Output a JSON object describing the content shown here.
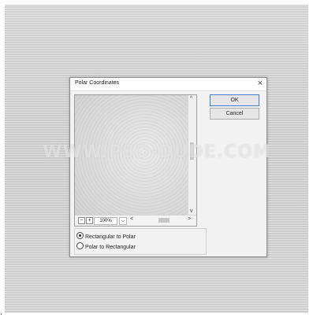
{
  "dialog": {
    "title": "Polar Coordinates",
    "close_glyph": "×",
    "ok_label": "OK",
    "cancel_label": "Cancel"
  },
  "preview": {
    "zoom_out_glyph": "−",
    "zoom_in_glyph": "+",
    "zoom_value": "100%",
    "zoom_dropdown_glyph": "⌵",
    "hscroll_left_glyph": "<",
    "hscroll_right_glyph": ">",
    "vscroll_up_glyph": "^",
    "vscroll_down_glyph": "v"
  },
  "options": {
    "rect_to_polar": "Rectangular to Polar",
    "polar_to_rect": "Polar to Rectangular",
    "selected": "Rectangular to Polar"
  },
  "watermark": "WWW.PSD-DUDE.COM",
  "corner_mark": "."
}
